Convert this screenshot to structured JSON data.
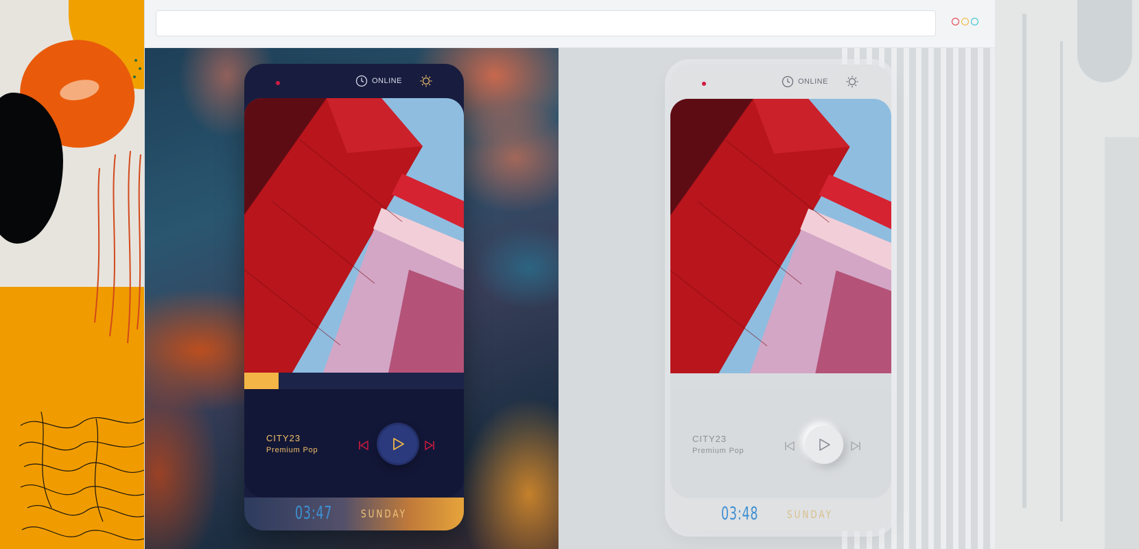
{
  "browser": {
    "address_placeholder": "",
    "window_controls": [
      {
        "name": "close",
        "color": "#e8333f"
      },
      {
        "name": "minimize",
        "color": "#f2b632"
      },
      {
        "name": "maximize",
        "color": "#2fc1c9"
      }
    ]
  },
  "players": [
    {
      "theme": "dark",
      "status": {
        "label": "ONLINE",
        "icons": [
          "record-dot",
          "clock-icon",
          "sun-icon"
        ]
      },
      "track": {
        "title": "CITY23",
        "genre": "Premium Pop",
        "progress": 0.155
      },
      "controls": {
        "icons": [
          "skip-back-icon",
          "play-icon",
          "skip-forward-icon"
        ]
      },
      "footer": {
        "time": "03:47",
        "day": "SUNDAY"
      },
      "colors": {
        "accent": "#f3b546",
        "panel": "#131737",
        "card": "#181d3f",
        "controls": "#d11b40",
        "time": "#3f8fd2"
      }
    },
    {
      "theme": "light",
      "status": {
        "label": "ONLINE",
        "icons": [
          "record-dot",
          "clock-icon",
          "sun-icon"
        ]
      },
      "track": {
        "title": "CITY23",
        "genre": "Premium Pop",
        "progress": 0.0
      },
      "controls": {
        "icons": [
          "skip-back-icon",
          "play-icon",
          "skip-forward-icon"
        ]
      },
      "footer": {
        "time": "03:48",
        "day": "SUNDAY"
      },
      "colors": {
        "accent": "#f3b546",
        "panel": "#d8dbdd",
        "card": "#dfe1e3",
        "controls": "#a0a4aa",
        "time": "#3f8fd2"
      }
    }
  ]
}
